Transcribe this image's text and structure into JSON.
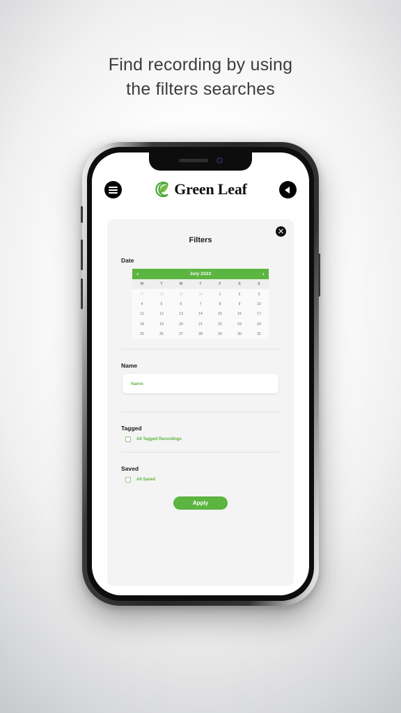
{
  "headline": {
    "line1": "Find recording by using",
    "line2": "the filters searches"
  },
  "app_header": {
    "menu_icon": "hamburger-menu-icon",
    "brand_name": "Green Leaf",
    "brand_logo_icon": "green-leaf-logo-icon",
    "back_icon": "chevron-left-icon"
  },
  "panel": {
    "title": "Filters",
    "close_icon": "close-icon",
    "close_glyph": "✕",
    "accent_color": "#5cb441",
    "sections": {
      "date": {
        "label": "Date",
        "calendar": {
          "month_year": "July 2022",
          "prev_glyph": "‹",
          "next_glyph": "›",
          "weekdays": [
            "M",
            "T",
            "W",
            "T",
            "F",
            "S",
            "S"
          ],
          "weeks": [
            [
              {
                "n": "27",
                "muted": true
              },
              {
                "n": "28",
                "muted": true
              },
              {
                "n": "29",
                "muted": true
              },
              {
                "n": "30",
                "muted": true
              },
              {
                "n": "1",
                "muted": false
              },
              {
                "n": "2",
                "muted": false
              },
              {
                "n": "3",
                "muted": false
              }
            ],
            [
              {
                "n": "4",
                "muted": false
              },
              {
                "n": "5",
                "muted": false
              },
              {
                "n": "6",
                "muted": false
              },
              {
                "n": "7",
                "muted": false
              },
              {
                "n": "8",
                "muted": false
              },
              {
                "n": "9",
                "muted": false
              },
              {
                "n": "10",
                "muted": false
              }
            ],
            [
              {
                "n": "11",
                "muted": false
              },
              {
                "n": "12",
                "muted": false
              },
              {
                "n": "13",
                "muted": false
              },
              {
                "n": "14",
                "muted": false
              },
              {
                "n": "15",
                "muted": false
              },
              {
                "n": "16",
                "muted": false
              },
              {
                "n": "17",
                "muted": false
              }
            ],
            [
              {
                "n": "18",
                "muted": false
              },
              {
                "n": "19",
                "muted": false
              },
              {
                "n": "20",
                "muted": false
              },
              {
                "n": "21",
                "muted": false
              },
              {
                "n": "22",
                "muted": false
              },
              {
                "n": "23",
                "muted": false
              },
              {
                "n": "24",
                "muted": false
              }
            ],
            [
              {
                "n": "25",
                "muted": false
              },
              {
                "n": "26",
                "muted": false
              },
              {
                "n": "27",
                "muted": false
              },
              {
                "n": "28",
                "muted": false
              },
              {
                "n": "29",
                "muted": false
              },
              {
                "n": "30",
                "muted": false
              },
              {
                "n": "31",
                "muted": false
              }
            ]
          ]
        }
      },
      "name": {
        "label": "Name",
        "input_value": "",
        "input_placeholder": "Name"
      },
      "tagged": {
        "label": "Tagged",
        "checkbox_label": "All Tagged Recordings",
        "checked": false
      },
      "saved": {
        "label": "Saved",
        "checkbox_label": "All Saved",
        "checked": false
      }
    },
    "apply_label": "Apply"
  }
}
